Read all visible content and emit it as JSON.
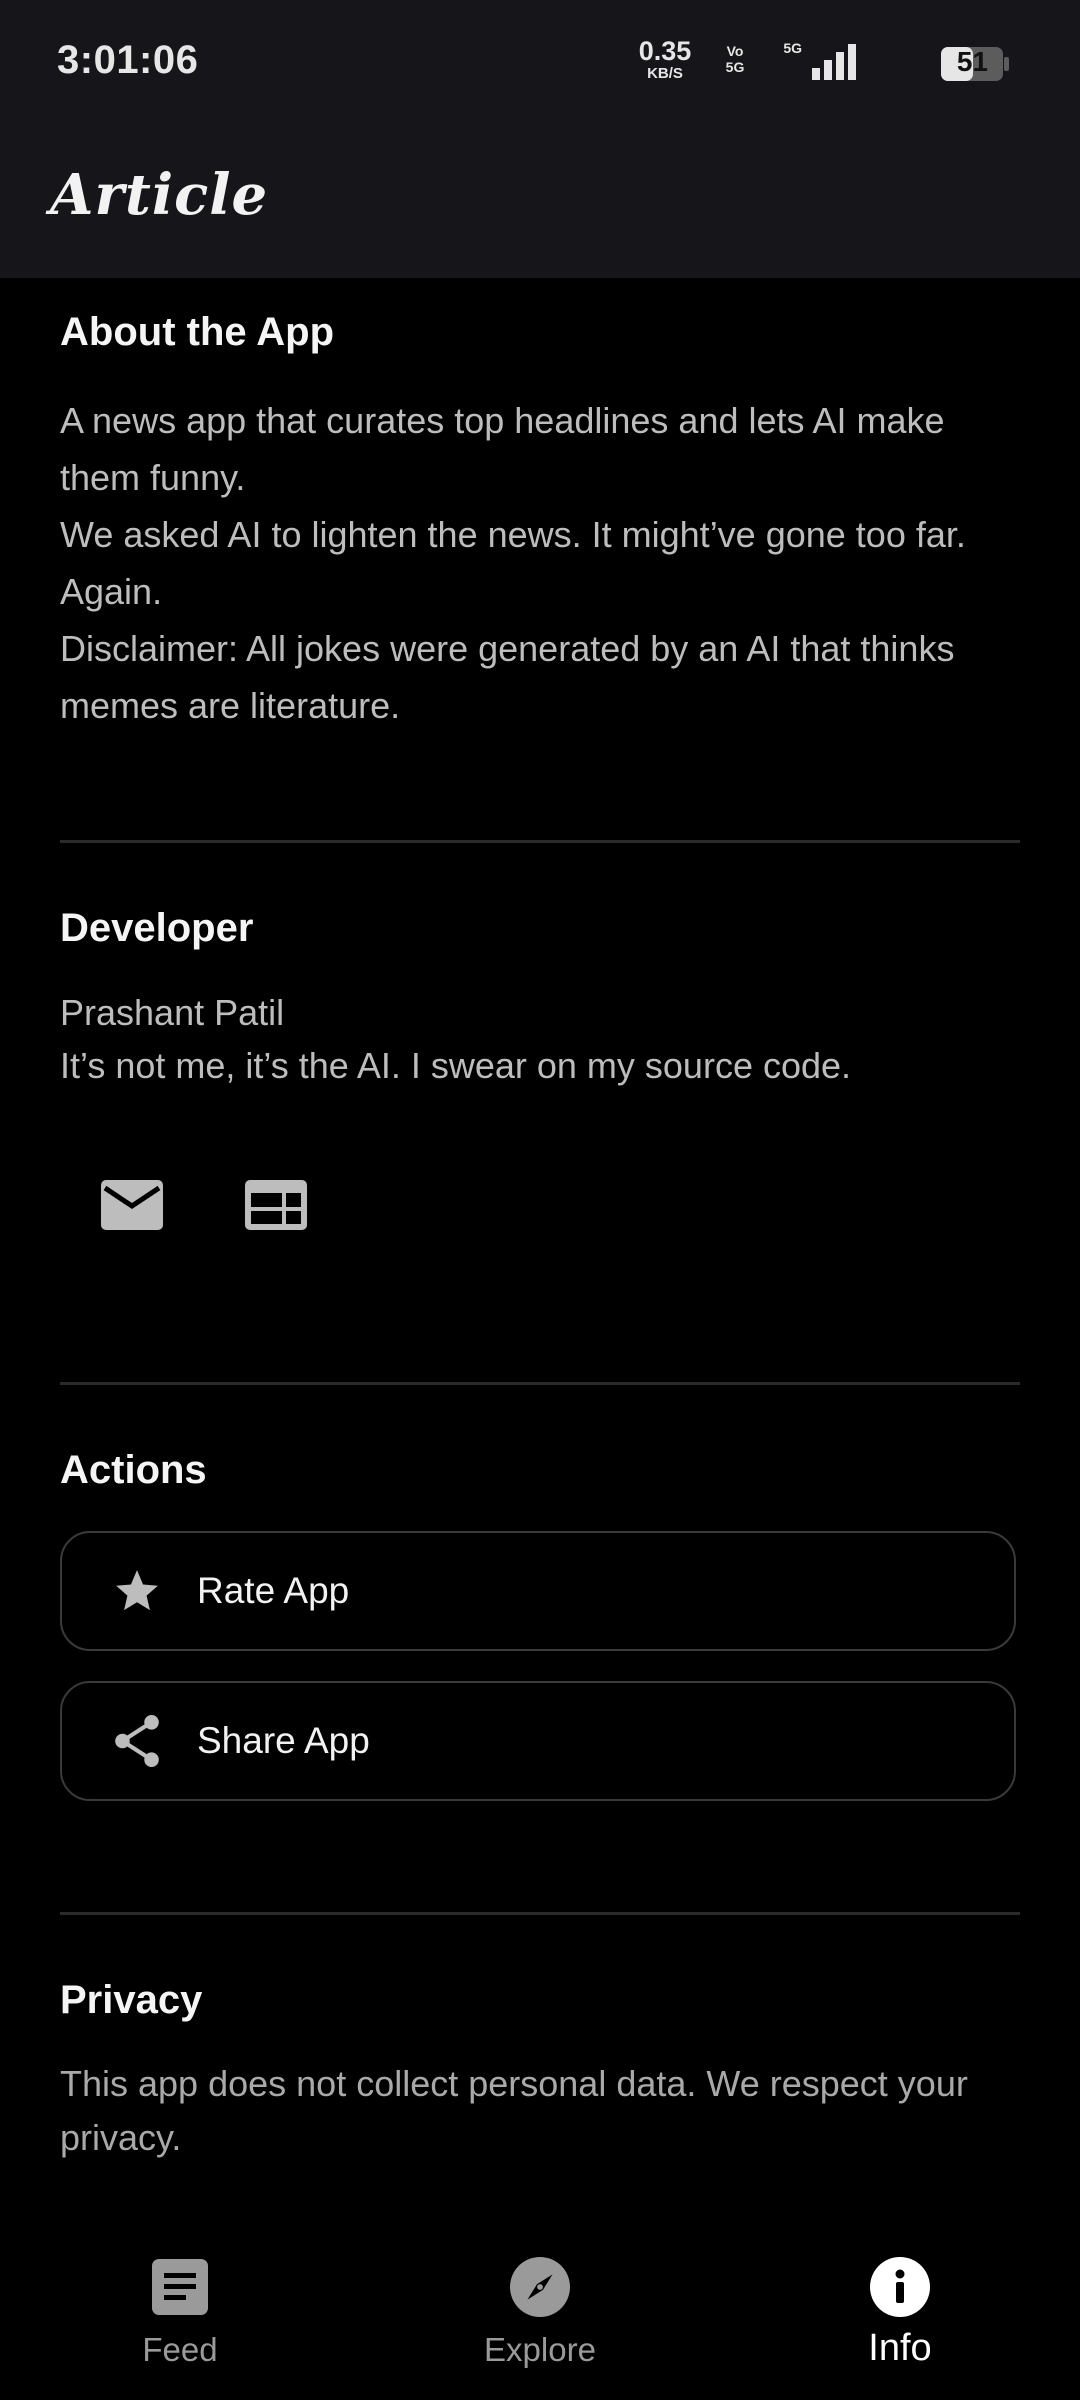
{
  "status_bar": {
    "time": "3:01:06",
    "net_speed_value": "0.35",
    "net_speed_unit": "KB/S",
    "volte_top": "Vo",
    "volte_bottom": "5G",
    "signal_label": "5G",
    "battery_level": "51"
  },
  "app_bar": {
    "title": "Article"
  },
  "about": {
    "title": "About the App",
    "lines": [
      "A news app that curates top headlines and lets AI make them funny.",
      "We asked AI to lighten the news. It might’ve gone too far. Again.",
      "Disclaimer: All jokes were generated by an AI that thinks memes are literature."
    ]
  },
  "developer": {
    "title": "Developer",
    "name": "Prashant Patil",
    "tagline": "It’s not me, it’s the AI. I swear on my source code.",
    "icons": [
      "email-icon",
      "web-icon"
    ]
  },
  "actions": {
    "title": "Actions",
    "rate_label": "Rate App",
    "share_label": "Share App"
  },
  "privacy": {
    "title": "Privacy",
    "text": "This app does not collect personal data. We respect your privacy."
  },
  "bottom_nav": {
    "items": [
      {
        "label": "Feed",
        "icon": "article-icon",
        "active": false
      },
      {
        "label": "Explore",
        "icon": "compass-icon",
        "active": false
      },
      {
        "label": "Info",
        "icon": "info-icon",
        "active": true
      }
    ]
  },
  "colors": {
    "background": "#000000",
    "bar": "#16161a",
    "text_primary": "#f5f5f5",
    "text_secondary": "#bdbdbd",
    "icon": "#bdbdbd"
  }
}
